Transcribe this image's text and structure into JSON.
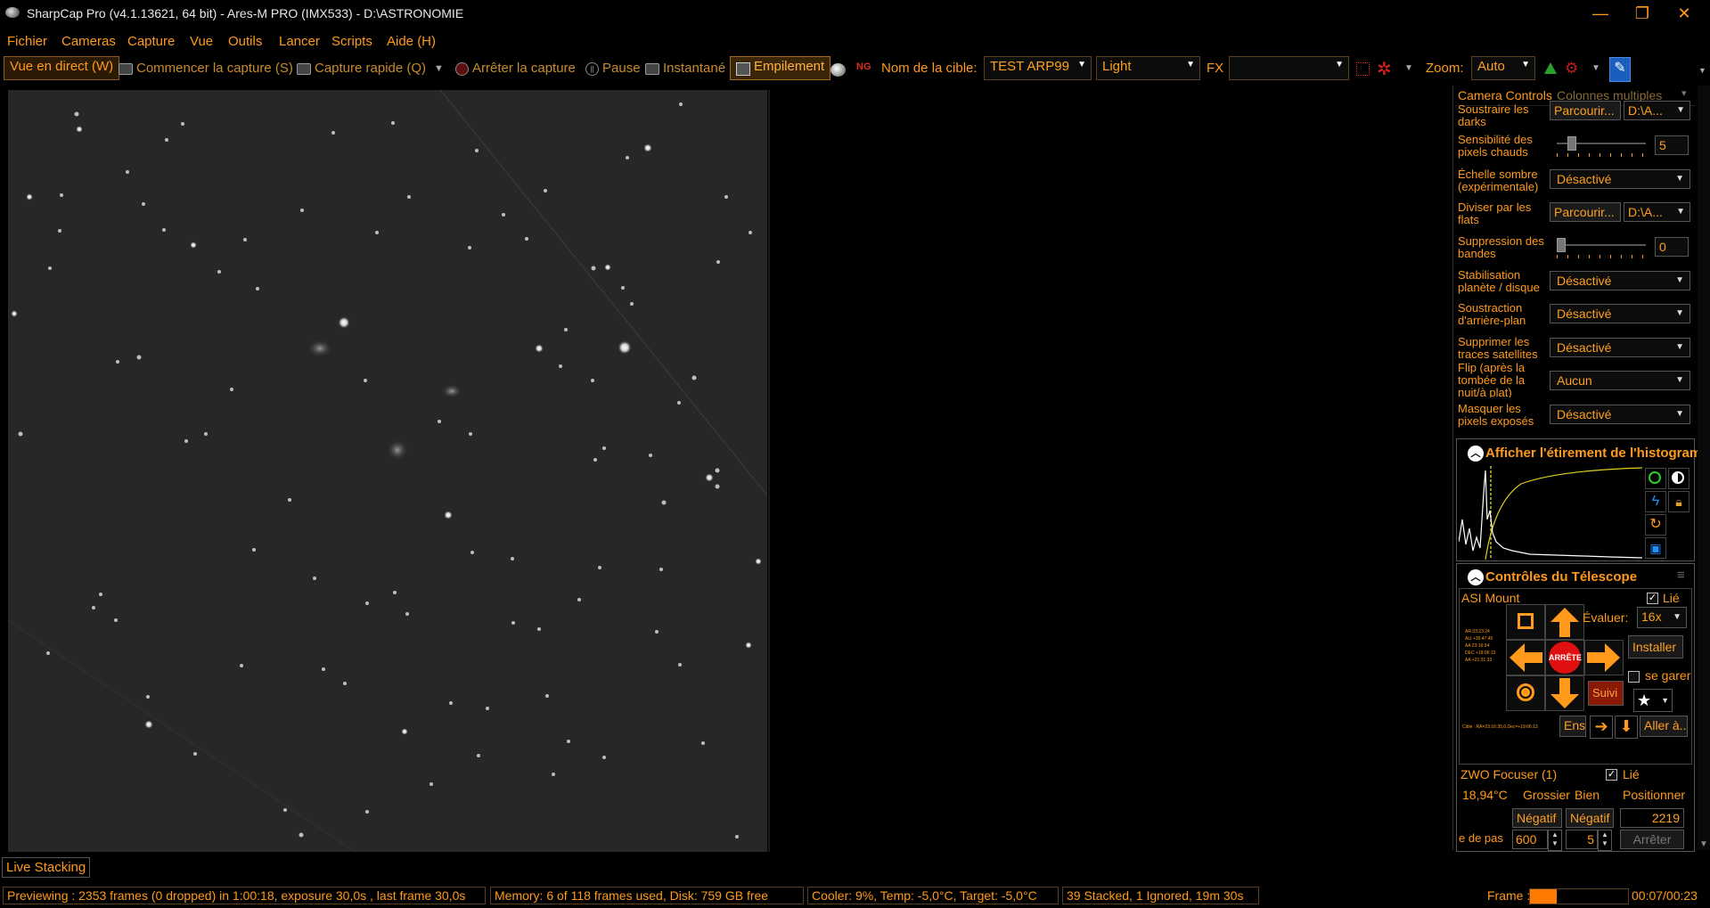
{
  "window": {
    "title": "SharpCap Pro (v4.1.13621, 64 bit) - Ares-M PRO (IMX533) - D:\\ASTRONOMIE",
    "minimize": "—",
    "restore": "❐",
    "close": "✕"
  },
  "menu": [
    "Fichier",
    "Cameras",
    "Capture",
    "Vue",
    "Outils",
    "Lancer",
    "Scripts",
    "Aide (H)"
  ],
  "toolbar": {
    "live_view": "Vue en direct (W)",
    "start_capture": "Commencer la capture (S)",
    "quick_capture": "Capture rapide (Q)",
    "stop_capture": "Arrêter la capture",
    "pause": "Pause",
    "snapshot": "Instantané",
    "stacking": "Empilement",
    "target_label": "Nom de la cible:",
    "target_value": "TEST ARP99",
    "frame_type": "Light",
    "fx_label": "FX",
    "fx_value": "",
    "zoom_label": "Zoom:",
    "zoom_value": "Auto"
  },
  "panel": {
    "tab_camera_controls": "Camera Controls",
    "tab_multi_columns": "Colonnes multiples",
    "rows": {
      "darks_label": "Soustraire les darks",
      "darks_browse": "Parcourir...",
      "darks_path": "D:\\A...",
      "hotpix_label": "Sensibilité des pixels chauds",
      "hotpix_value": "5",
      "darkscale_label": "Échelle sombre (expérimentale)",
      "darkscale_value": "Désactivé",
      "flats_label": "Diviser par les flats",
      "flats_browse": "Parcourir...",
      "flats_path": "D:\\A...",
      "banding_label": "Suppression des bandes",
      "banding_value": "0",
      "stab_label": "Stabilisation planète / disque",
      "stab_value": "Désactivé",
      "bg_label": "Soustraction d'arrière-plan",
      "bg_value": "Désactivé",
      "sat_label": "Supprimer les traces satellites",
      "sat_value": "Désactivé",
      "flip_label": "Flip (après la tombée de la nuit/à plat)",
      "flip_value": "Aucun",
      "mask_label": "Masquer les pixels exposés",
      "mask_value": "Désactivé"
    },
    "histogram_title": "Afficher l'étirement de l'histogram",
    "telescope_title": "Contrôles du Télescope",
    "mount": {
      "name": "ASI Mount",
      "linked_label": "Lié",
      "rate_label": "Évaluer:",
      "rate_value": "16x",
      "install": "Installer",
      "park_label": "se garer",
      "stop_label": "ARRÊTE",
      "tracking": "Suivi",
      "sync": "Ens",
      "goto": "Aller à..",
      "coords": [
        "AR  03:23:24",
        "ALt  +35:47:45",
        "AA   23:16:34",
        "DEC  +19:06:13",
        "AA   +21:31:33"
      ],
      "footer": "Cible : RA=23:16:35,0,Dec=+19:06:13"
    },
    "focuser": {
      "name": "ZWO Focuser (1)",
      "linked_label": "Lié",
      "temp": "18,94°C",
      "coarse": "Grossier",
      "fine": "Bien",
      "position_label": "Positionner",
      "neg_coarse": "Négatif",
      "neg_fine": "Négatif",
      "position_value": "2219",
      "step_label": "e de pas",
      "step_coarse": "600",
      "step_fine": "5",
      "stop": "Arrêter"
    }
  },
  "status": {
    "live_stacking": "Live Stacking",
    "previewing": "Previewing : 2353 frames (0 dropped) in 1:00:18, exposure 30,0s , last frame 30,0s",
    "memory": "Memory: 6 of 118 frames used, Disk: 759 GB free",
    "cooler": "Cooler: 9%, Temp: -5,0°C, Target: -5,0°C",
    "stacked": "39 Stacked, 1 Ignored, 19m 30s",
    "frame_label": "Frame :",
    "frame_progress": 0.27,
    "frame_time": "00:07/00:23"
  },
  "colors": {
    "accent": "#ff9a1a",
    "background": "#000000",
    "image_bg": "#272727",
    "stop_red": "#e01010"
  }
}
